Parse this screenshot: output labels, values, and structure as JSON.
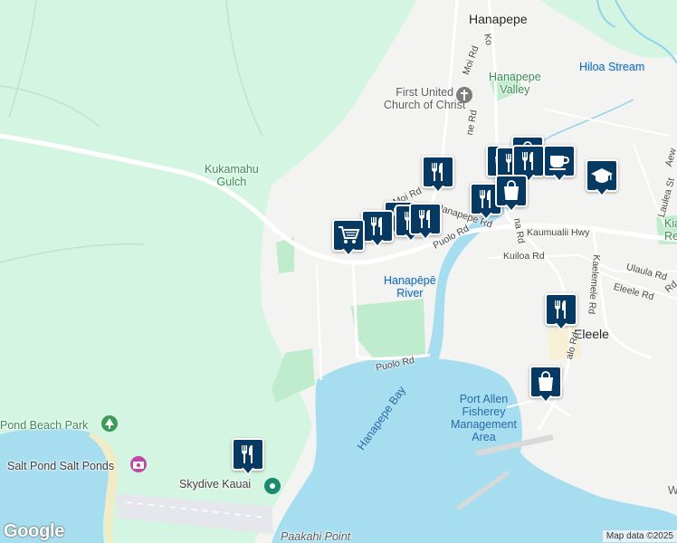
{
  "map": {
    "labels": {
      "hanapepe": "Hanapepe",
      "hanapepe_valley": "Hanapepe\nValley",
      "hiloa_stream": "Hiloa Stream",
      "first_united": "First United\nChurch of Christ",
      "kukamahu": "Kukamahu\nGulch",
      "hanapepe_river": "Hanapēpē\nRiver",
      "eleele": "Eleele",
      "port_allen": "Port Allen\nFisherey\nManagement\nArea",
      "hanapepe_bay": "Hanapepe Bay",
      "pond_beach_park": "Pond Beach Park",
      "salt_pond": "Salt Pond Salt Ponds",
      "skydive": "Skydive Kauai",
      "paakahi": "Paakahi Point",
      "kia_rese": "Kia\nRese",
      "w_edge": "W"
    },
    "roads": {
      "moi_rd_north": "Moi Rd",
      "moi_rd": "Moi Rd",
      "hanapepe_rd": "Hanapepe Rd",
      "puolo_rd": "Puolo Rd",
      "puolo_rd_south": "Puolo Rd",
      "kaumualii_hwy": "Kaumualii Hwy",
      "kuiloa_rd": "Kuiloa Rd",
      "ulaula_rd": "Ulaula Rd",
      "eleele_rd": "Eleele Rd",
      "laulea_st": "Laulea St",
      "aew": "Aew",
      "ko": "Ko",
      "ne_rd": "ne Rd",
      "na_rd": "na Rd",
      "kaelemele_rd": "Kaelemele Rd",
      "waialo_rd": "alo Rd",
      "rd_partial": "Rd"
    },
    "pins": [
      {
        "name": "restaurant-pin-moi",
        "icon": "fork-knife"
      },
      {
        "name": "shopping-pin-north-1",
        "icon": "shopping-bag"
      },
      {
        "name": "shopping-pin-north-2",
        "icon": "shopping-bag"
      },
      {
        "name": "restaurant-pin-north-1",
        "icon": "fork-knife"
      },
      {
        "name": "restaurant-pin-north-2",
        "icon": "fork-knife"
      },
      {
        "name": "cafe-pin",
        "icon": "coffee-cup"
      },
      {
        "name": "restaurant-pin-hanapepe-rd",
        "icon": "fork-knife"
      },
      {
        "name": "shopping-pin-hanapepe-rd",
        "icon": "shopping-bag"
      },
      {
        "name": "school-pin",
        "icon": "graduation-cap"
      },
      {
        "name": "restaurant-pin-cluster-1",
        "icon": "fork-knife"
      },
      {
        "name": "restaurant-pin-cluster-2",
        "icon": "fork-knife"
      },
      {
        "name": "restaurant-pin-cluster-3",
        "icon": "fork-knife"
      },
      {
        "name": "restaurant-pin-cluster-4",
        "icon": "fork-knife"
      },
      {
        "name": "grocery-pin",
        "icon": "shopping-cart"
      },
      {
        "name": "restaurant-pin-eleele",
        "icon": "fork-knife"
      },
      {
        "name": "shopping-pin-port-allen",
        "icon": "shopping-bag"
      },
      {
        "name": "restaurant-pin-skydive",
        "icon": "fork-knife"
      }
    ],
    "colors": {
      "water": "#a6def0",
      "green": "#d5f5e3",
      "park": "#c0ecce",
      "land": "#f3f3f2",
      "pin": "#063a63"
    }
  },
  "footer": {
    "logo": "Google",
    "attribution": "Map data ©2025"
  }
}
